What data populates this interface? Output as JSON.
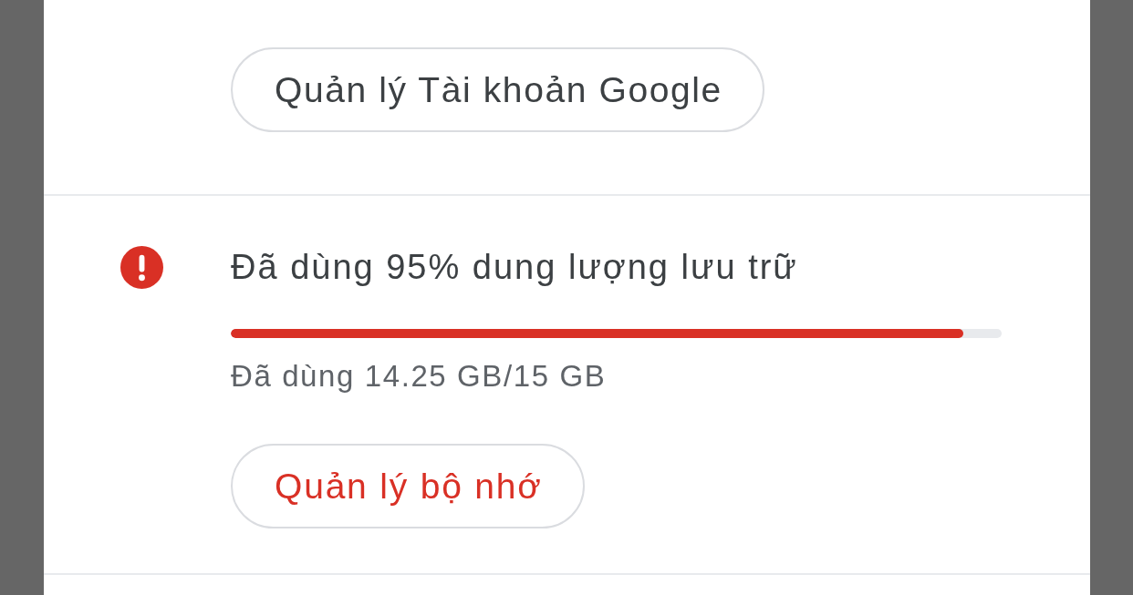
{
  "account_button": {
    "label": "Quản lý Tài khoản Google"
  },
  "storage": {
    "alert": true,
    "title": "Đã dùng 95% dung lượng lưu trữ",
    "level": 0.95,
    "usage": "Đã dùng 14.25 GB/15 GB",
    "button": {
      "label": "Quản lý bộ nhớ"
    }
  }
}
